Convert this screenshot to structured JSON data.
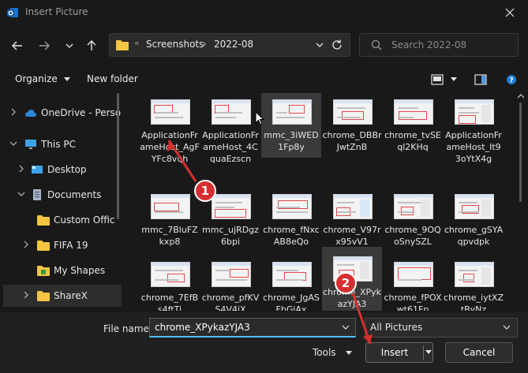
{
  "window": {
    "title": "Insert Picture",
    "app_icon": "outlook-icon",
    "close_icon": "close-icon"
  },
  "navigation": {
    "back_icon": "arrow-left-icon",
    "forward_icon": "arrow-right-icon",
    "recent_icon": "chevron-down-icon",
    "up_icon": "arrow-up-icon",
    "breadcrumb": [
      "Screenshots",
      "2022-08"
    ],
    "refresh_icon": "refresh-icon"
  },
  "search": {
    "placeholder": "Search 2022-08"
  },
  "toolbar": {
    "organize_label": "Organize",
    "new_folder_label": "New folder"
  },
  "sidebar": {
    "items": [
      {
        "label": "OneDrive - Perso",
        "icon": "cloud-icon"
      },
      {
        "label": "This PC",
        "icon": "monitor-icon"
      },
      {
        "label": "Desktop",
        "icon": "desktop-icon"
      },
      {
        "label": "Documents",
        "icon": "document-icon"
      },
      {
        "label": "Custom Offic",
        "icon": "folder-icon"
      },
      {
        "label": "FIFA 19",
        "icon": "folder-icon"
      },
      {
        "label": "My Shapes",
        "icon": "shapes-folder-icon"
      },
      {
        "label": "ShareX",
        "icon": "folder-icon"
      }
    ]
  },
  "files": [
    {
      "name": "ApplicationFrameHost_AgFYFc8vqh"
    },
    {
      "name": "ApplicationFrameHost_4CquaEzscn"
    },
    {
      "name": "mmc_3iWED1Fp8y"
    },
    {
      "name": "chrome_DBBrJwtZnB"
    },
    {
      "name": "chrome_tvSEql2KHq"
    },
    {
      "name": "ApplicationFrameHost_It93oYtX4g"
    },
    {
      "name": "mmc_7BluFZkxp8"
    },
    {
      "name": "mmc_ujRDgz6bpi"
    },
    {
      "name": "chrome_fNxcAB8eQo"
    },
    {
      "name": "chrome_V97rx95vV1"
    },
    {
      "name": "chrome_9OQoSnySZL"
    },
    {
      "name": "chrome_gSYAqpvdpk"
    },
    {
      "name": "chrome_7EfBs4ftTi"
    },
    {
      "name": "chrome_pfKVS4V4jX"
    },
    {
      "name": "chrome_JgASFbGjAx"
    },
    {
      "name": "chrome_XPykazYJA3"
    },
    {
      "name": "chrome_fPOXwt61Fp"
    },
    {
      "name": "chrome_iytXZtByNz"
    }
  ],
  "footer": {
    "file_name_label": "File name:",
    "file_name_value": "chrome_XPykazYJA3",
    "filter_value": "All Pictures",
    "tools_label": "Tools",
    "insert_label": "Insert",
    "cancel_label": "Cancel"
  },
  "annotations": {
    "badge_1": "1",
    "badge_2": "2",
    "color": "#d62f2f"
  }
}
